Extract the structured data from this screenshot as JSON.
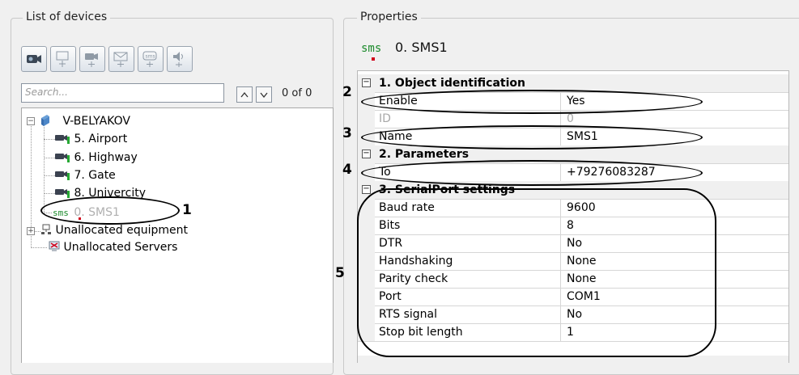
{
  "left_panel": {
    "title": "List of devices",
    "search": {
      "placeholder": "Search...",
      "value": ""
    },
    "count": "0 of 0",
    "tree": {
      "server": "V-BELYAKOV",
      "devices": [
        "5. Airport",
        "6. Highway",
        "7. Gate",
        "8. Univercity"
      ],
      "sms_prefix": "sms",
      "sms_item": "0. SMS1",
      "unallocated_equipment": "Unallocated equipment",
      "unallocated_servers": "Unallocated Servers"
    }
  },
  "right_panel": {
    "title": "Properties",
    "object_icon": "sms",
    "object_name": "0. SMS1",
    "categories": [
      {
        "title": "1. Object identification",
        "rows": [
          {
            "key": "Enable",
            "value": "Yes"
          },
          {
            "key": "ID",
            "value": "0"
          },
          {
            "key": "Name",
            "value": "SMS1"
          }
        ]
      },
      {
        "title": "2. Parameters",
        "rows": [
          {
            "key": "To",
            "value": "+79276083287"
          }
        ]
      },
      {
        "title": "3. SerialPort settings",
        "rows": [
          {
            "key": "Baud rate",
            "value": "9600"
          },
          {
            "key": "Bits",
            "value": "8"
          },
          {
            "key": "DTR",
            "value": "No"
          },
          {
            "key": "Handshaking",
            "value": "None"
          },
          {
            "key": "Parity check",
            "value": "None"
          },
          {
            "key": "Port",
            "value": "COM1"
          },
          {
            "key": "RTS signal",
            "value": "No"
          },
          {
            "key": "Stop bit length",
            "value": "1"
          }
        ]
      }
    ]
  },
  "callouts": [
    "1",
    "2",
    "3",
    "4",
    "5"
  ],
  "colors": {
    "sms_green": "#1a8a2a",
    "accent_red": "#d0021b",
    "disabled_gray": "#a8a8a8"
  },
  "icons": [
    "camera-icon",
    "add-object-icon",
    "add-camera-icon",
    "add-email-icon",
    "add-sms-icon",
    "add-sound-icon",
    "chevron-up-icon",
    "chevron-down-icon",
    "server-icon",
    "network-icon",
    "server-unallocated-icon"
  ]
}
